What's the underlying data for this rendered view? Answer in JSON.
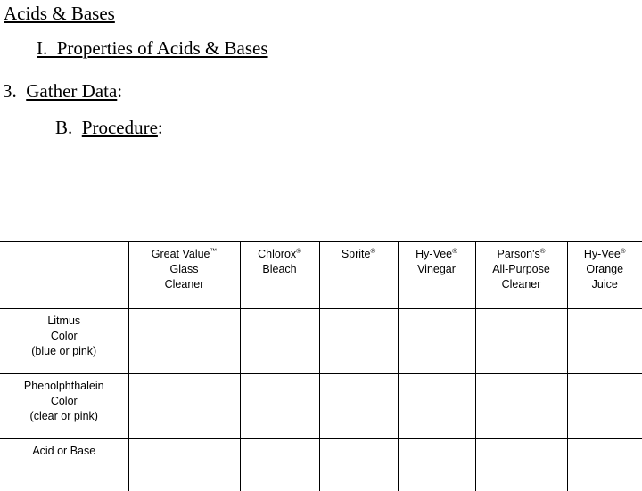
{
  "slide": {
    "title": "Acids & Bases",
    "section": "I.  Properties of Acids & Bases",
    "item": "3.  Gather Data",
    "item_suffix": ":",
    "subitem_prefix": "B.  ",
    "subitem": "Procedure",
    "subitem_suffix": ":"
  },
  "heading_parts": {
    "title_text": "Acids & Bases",
    "section_text": "I.  Properties of Acids & Bases",
    "item_number": "3.  ",
    "item_text": "Gather Data",
    "item_colon": ":",
    "sub_letter": "B.  ",
    "sub_text": "Procedure",
    "sub_colon": ":"
  },
  "table": {
    "corner_label": "",
    "columns": [
      {
        "lines": [
          "Great Value",
          "Glass",
          "Cleaner"
        ],
        "mark": "™",
        "mark_line": 0
      },
      {
        "lines": [
          "Chlorox",
          "Bleach"
        ],
        "mark": "®",
        "mark_line": 0
      },
      {
        "lines": [
          "Sprite"
        ],
        "mark": "®",
        "mark_line": 0
      },
      {
        "lines": [
          "Hy-Vee",
          "Vinegar"
        ],
        "mark": "®",
        "mark_line": 0
      },
      {
        "lines": [
          "Parson's",
          "All-Purpose",
          "Cleaner"
        ],
        "mark": "®",
        "mark_line": 0
      },
      {
        "lines": [
          "Hy-Vee",
          "Orange",
          "Juice"
        ],
        "mark": "®",
        "mark_line": 0
      }
    ],
    "rows": [
      {
        "label_lines": [
          "Litmus",
          "Color",
          "(blue or pink)"
        ],
        "cells": [
          "",
          "",
          "",
          "",
          "",
          ""
        ]
      },
      {
        "label_lines": [
          "Phenolphthalein",
          "Color",
          "(clear or pink)"
        ],
        "cells": [
          "",
          "",
          "",
          "",
          "",
          ""
        ]
      },
      {
        "label_lines": [
          "Acid or Base"
        ],
        "cells": [
          "",
          "",
          "",
          "",
          "",
          ""
        ]
      }
    ]
  },
  "colors": {
    "background": "#ffffff",
    "text": "#000000",
    "table_border": "#000000"
  }
}
